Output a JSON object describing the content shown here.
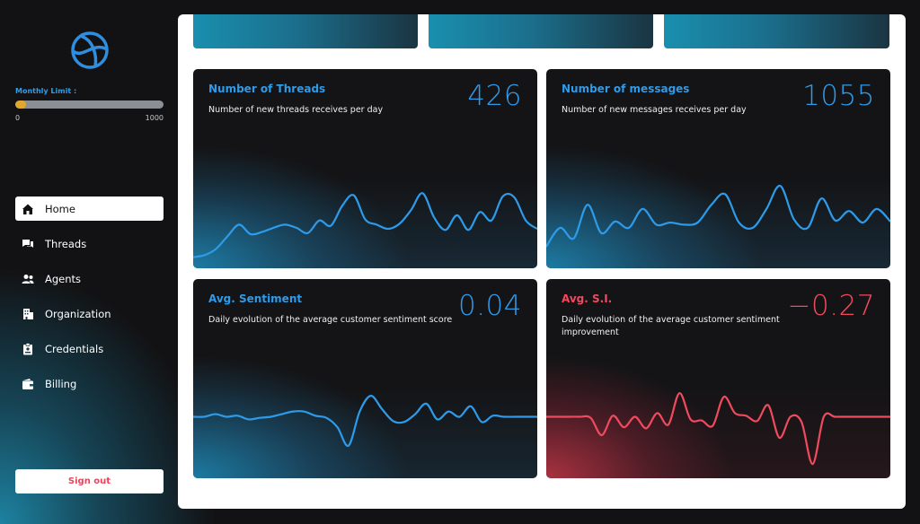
{
  "sidebar": {
    "logo_icon": "globe-logo-icon",
    "monthly_limit": {
      "label": "Monthly Limit :",
      "min": "0",
      "max": "1000",
      "progress_fraction": 0.07
    },
    "nav": [
      {
        "label": "Home",
        "icon": "home-icon",
        "active": true
      },
      {
        "label": "Threads",
        "icon": "chat-icon",
        "active": false
      },
      {
        "label": "Agents",
        "icon": "users-icon",
        "active": false
      },
      {
        "label": "Organization",
        "icon": "building-icon",
        "active": false
      },
      {
        "label": "Credentials",
        "icon": "badge-icon",
        "active": false
      },
      {
        "label": "Billing",
        "icon": "wallet-icon",
        "active": false
      }
    ],
    "signout_label": "Sign out"
  },
  "cards": [
    {
      "title": "Number of Threads",
      "subtitle": "Number of new threads receives per day",
      "value": "426",
      "accent": "#2e9bea",
      "series": [
        2,
        4,
        10,
        22,
        33,
        24,
        26,
        30,
        33,
        30,
        25,
        37,
        32,
        51,
        61,
        38,
        33,
        29,
        34,
        47,
        63,
        40,
        28,
        42,
        28,
        45,
        37,
        60,
        59,
        37,
        29
      ],
      "ylim": [
        0,
        100
      ]
    },
    {
      "title": "Number of messages",
      "subtitle": "Number of new messages receives per day",
      "value": "1055",
      "accent": "#2e9bea",
      "series": [
        12,
        30,
        20,
        52,
        25,
        36,
        30,
        48,
        33,
        35,
        33,
        35,
        52,
        62,
        35,
        30,
        48,
        70,
        38,
        30,
        58,
        37,
        46,
        35,
        48,
        36
      ],
      "ylim": [
        0,
        100
      ]
    },
    {
      "title": "Avg. Sentiment",
      "subtitle": "Daily evolution of the average customer sentiment score",
      "value": "0.04",
      "accent": "#2e9bea",
      "series": [
        0,
        0,
        0.05,
        0,
        0.02,
        -0.05,
        -0.02,
        0,
        0.05,
        0.1,
        0.1,
        0.02,
        -0.02,
        -0.2,
        -0.55,
        0.1,
        0.4,
        0.15,
        -0.08,
        -0.1,
        0.05,
        0.25,
        -0.05,
        0.1,
        0.0,
        0.2,
        -0.1,
        0.02,
        0,
        0,
        0,
        0
      ],
      "ylim": [
        -1,
        1
      ]
    },
    {
      "title": "Avg. S.I.",
      "subtitle": "Daily evolution of the average customer sentiment improvement",
      "value": "−0.27",
      "accent": "#ef4a5e",
      "series": [
        0,
        0,
        0,
        0,
        -0.02,
        -0.35,
        0.02,
        -0.2,
        0.0,
        -0.22,
        0.07,
        -0.15,
        0.45,
        -0.05,
        -0.07,
        -0.17,
        0.38,
        0.07,
        0.02,
        -0.08,
        0.22,
        -0.4,
        0.0,
        -0.1,
        -0.9,
        0.0,
        0.0,
        0,
        0,
        0,
        0,
        0
      ],
      "ylim": [
        -1,
        1
      ]
    }
  ]
}
